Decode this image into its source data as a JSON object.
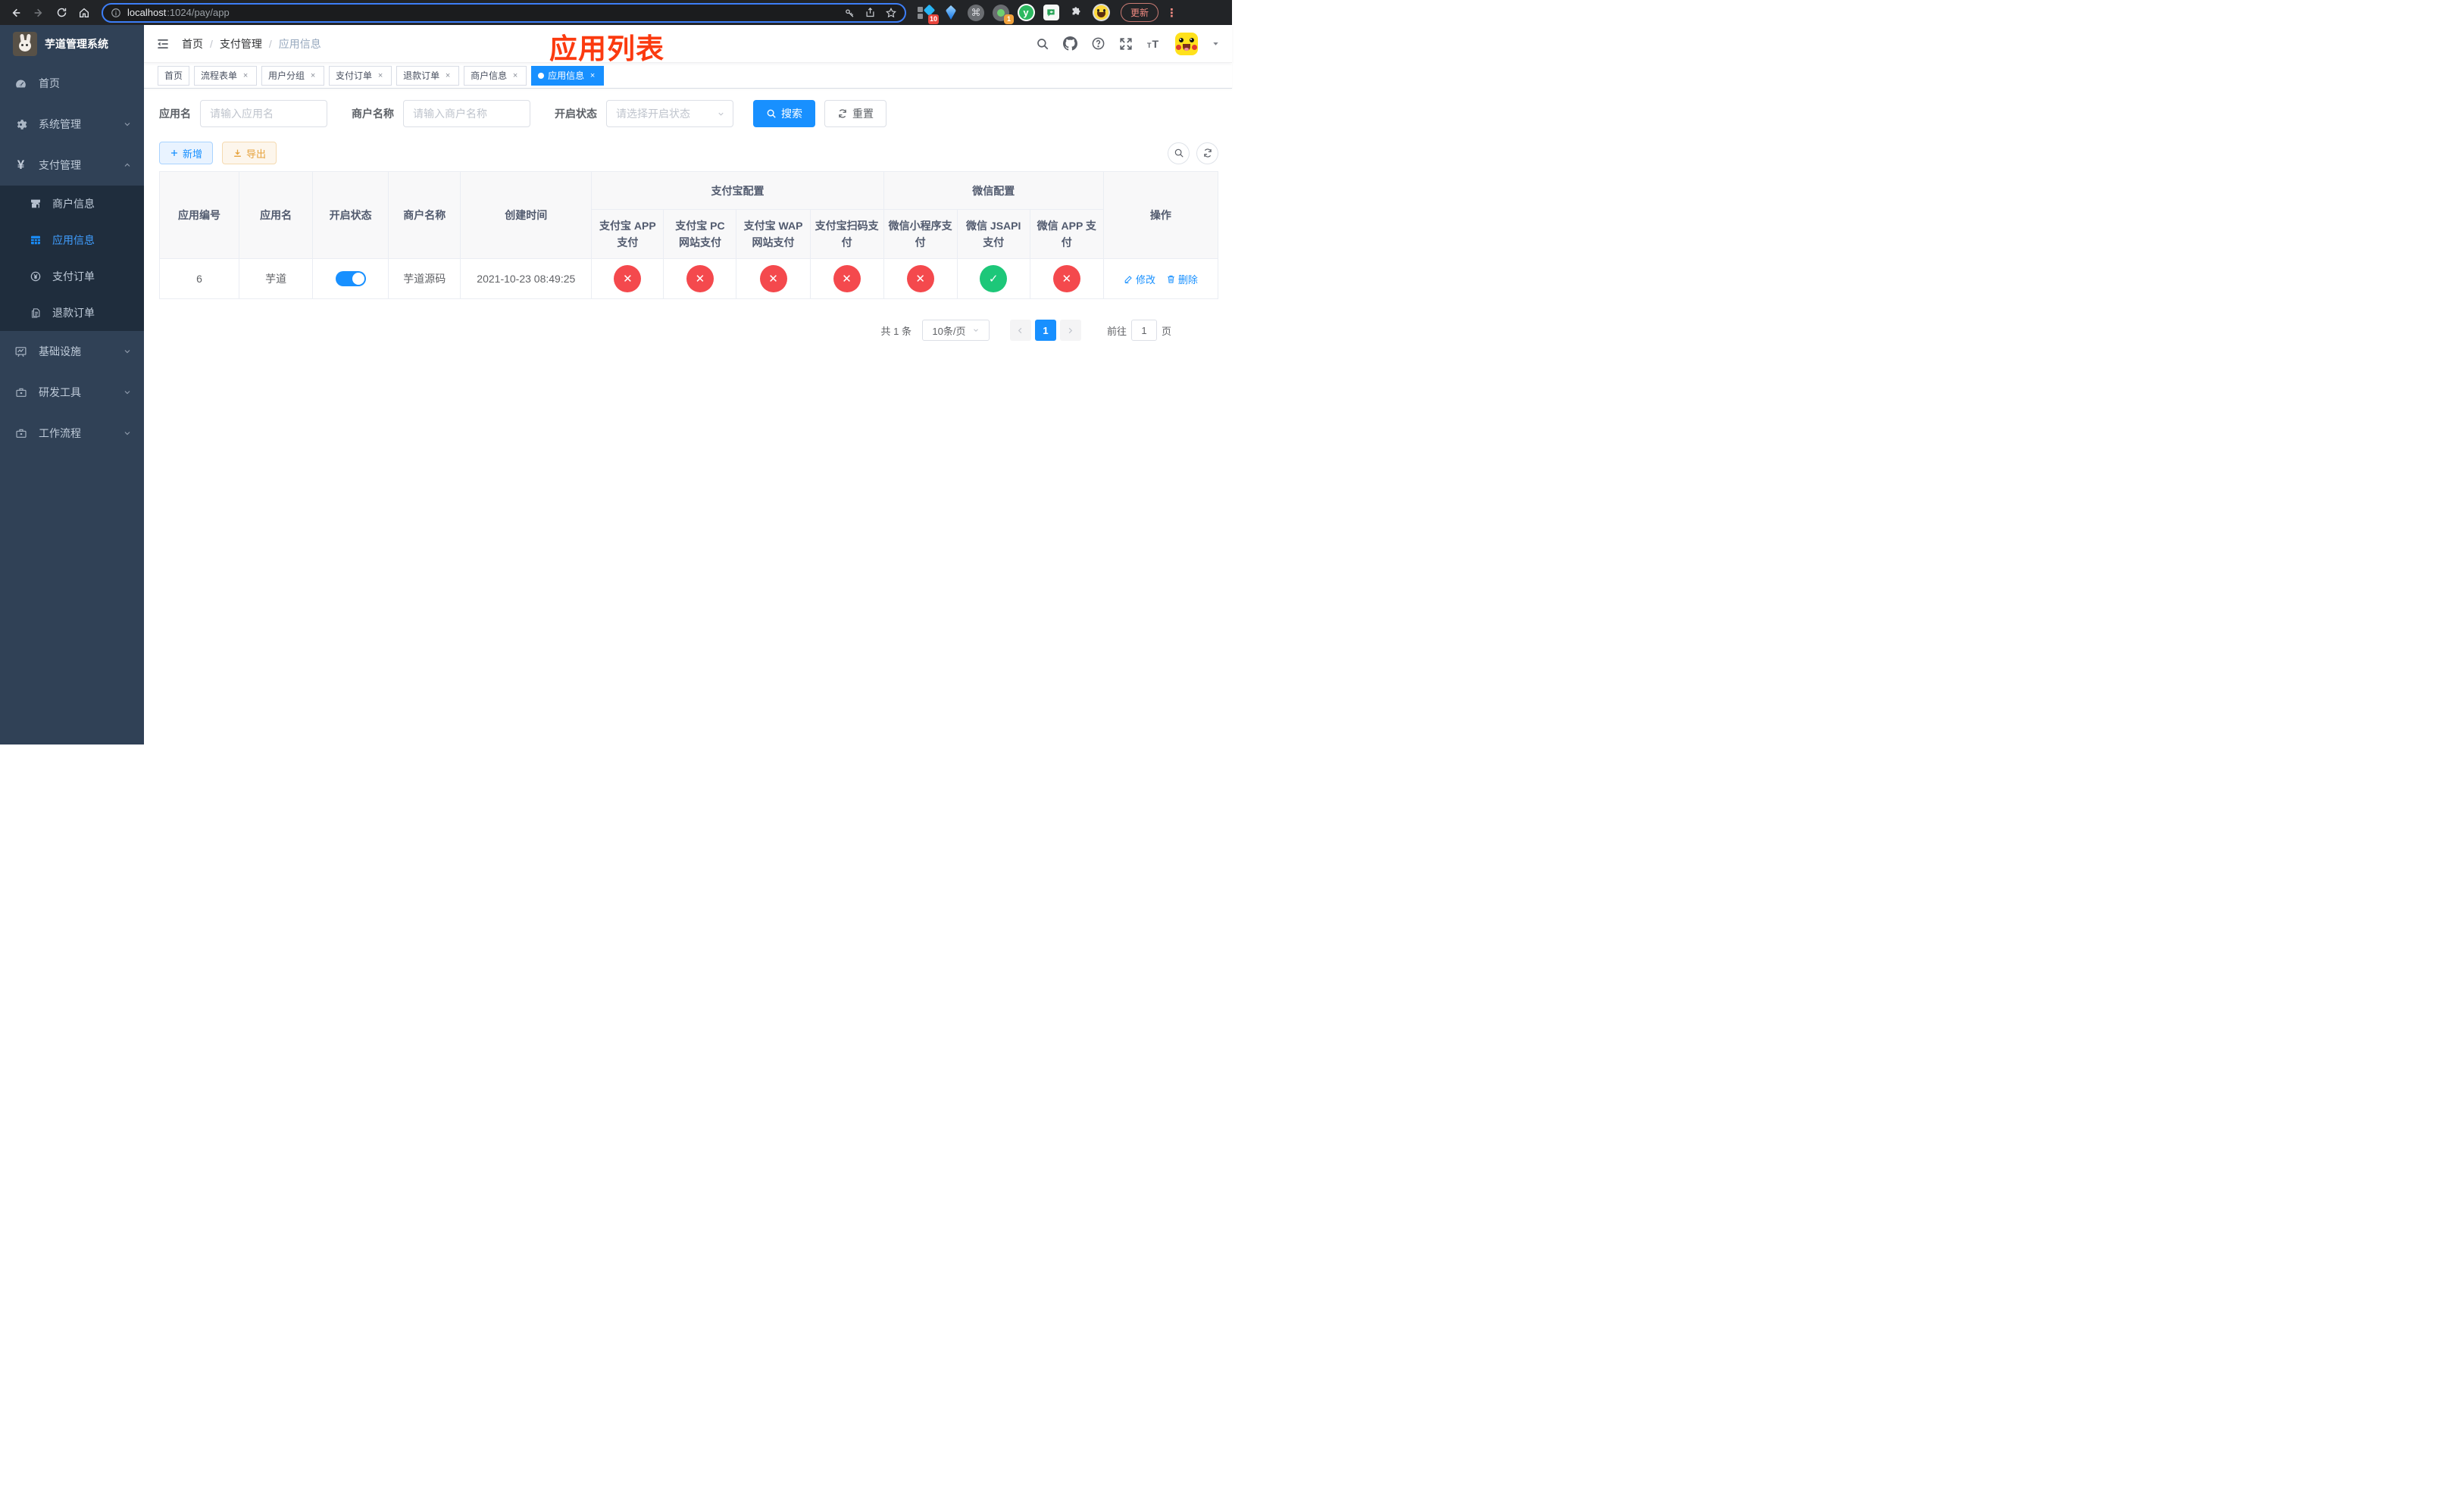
{
  "colors": {
    "primary": "#1890ff",
    "success": "#1dc779",
    "danger": "#f4494d",
    "annotation_red": "#fb3a0f",
    "sidebar_bg": "#304156",
    "submenu_bg": "#1f2d3d"
  },
  "browser": {
    "url": {
      "host": "localhost",
      "rest": ":1024/pay/app"
    },
    "update_label": "更新",
    "ext": {
      "badge_blue_diamond": "10",
      "badge_gray_dot": "1",
      "yuque_letter": "y"
    }
  },
  "icons": {
    "close": "×",
    "dots": "⋮",
    "command": "⌘",
    "slash": "/",
    "check": "✓",
    "cross": "✕"
  },
  "sidebar": {
    "title": "芋道管理系统",
    "items": [
      {
        "label": "首页"
      },
      {
        "label": "系统管理"
      },
      {
        "label": "支付管理"
      },
      {
        "label": "基础设施"
      },
      {
        "label": "研发工具"
      },
      {
        "label": "工作流程"
      }
    ],
    "submenu": [
      {
        "label": "商户信息"
      },
      {
        "label": "应用信息"
      },
      {
        "label": "支付订单"
      },
      {
        "label": "退款订单"
      }
    ]
  },
  "navbar": {
    "breadcrumb": [
      "首页",
      "支付管理",
      "应用信息"
    ]
  },
  "annotation": "应用列表",
  "tabs": [
    {
      "label": "首页"
    },
    {
      "label": "流程表单"
    },
    {
      "label": "用户分组"
    },
    {
      "label": "支付订单"
    },
    {
      "label": "退款订单"
    },
    {
      "label": "商户信息"
    },
    {
      "label": "应用信息"
    }
  ],
  "filters": {
    "app_name_label": "应用名",
    "app_name_placeholder": "请输入应用名",
    "merchant_label": "商户名称",
    "merchant_placeholder": "请输入商户名称",
    "status_label": "开启状态",
    "status_placeholder": "请选择开启状态",
    "search_label": "搜索",
    "reset_label": "重置"
  },
  "toolbar": {
    "add_label": "新增",
    "export_label": "导出"
  },
  "table": {
    "headers": {
      "app_id": "应用编号",
      "app_name": "应用名",
      "open_status": "开启状态",
      "merchant_name": "商户名称",
      "create_time": "创建时间",
      "alipay_group": "支付宝配置",
      "wechat_group": "微信配置",
      "actions": "操作",
      "sub": [
        "支付宝 APP 支付",
        "支付宝 PC 网站支付",
        "支付宝 WAP 网站支付",
        "支付宝扫码支付",
        "微信小程序支付",
        "微信 JSAPI 支付",
        "微信 APP 支付"
      ]
    },
    "row": {
      "app_id": "6",
      "app_name": "芋道",
      "open_status_on": true,
      "merchant_name": "芋道源码",
      "create_time": "2021-10-23 08:49:25",
      "statuses": [
        "no",
        "no",
        "no",
        "no",
        "no",
        "yes",
        "no"
      ],
      "edit_label": "修改",
      "delete_label": "删除"
    }
  },
  "pagination": {
    "total": "共 1 条",
    "page_size": "10条/页",
    "current_page": "1",
    "goto_label": "前往",
    "goto_value": "1",
    "page_unit": "页"
  }
}
